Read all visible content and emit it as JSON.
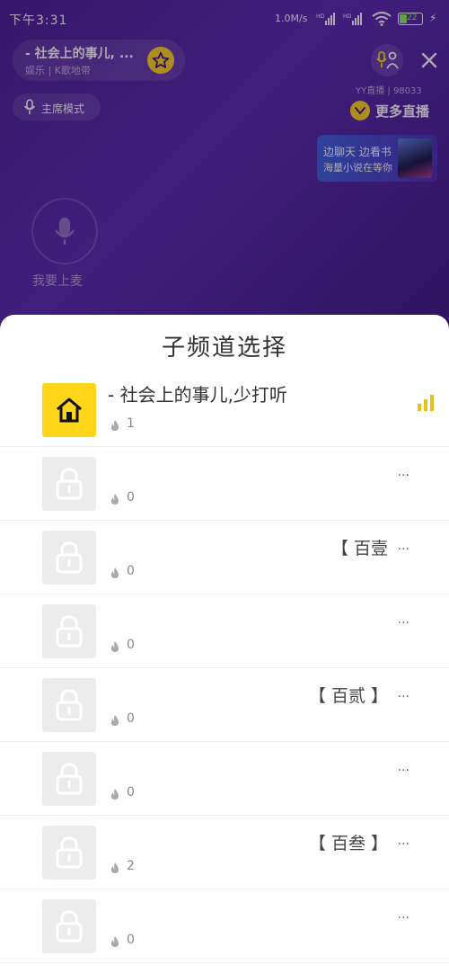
{
  "status_bar": {
    "time": "下午3:31",
    "network_speed": "1.0M/s",
    "sim1": "HD",
    "sim2": "HD",
    "battery": "22"
  },
  "room": {
    "title": "- 社会上的事儿, ...",
    "subtitle": "娱乐 | K歌地带"
  },
  "mode_button": "主席模式",
  "yy_info": "YY直播 | 98033",
  "more_live": "更多直播",
  "ad": {
    "line1": "边聊天 边看书",
    "line2": "海量小说在等你"
  },
  "mic_label": "我要上麦",
  "sheet": {
    "title": "子频道选择",
    "rows": [
      {
        "name": "- 社会上的事儿,少打听",
        "count": "1",
        "locked": false,
        "ellipsis": ""
      },
      {
        "name": "",
        "count": "0",
        "locked": true,
        "ellipsis": "..."
      },
      {
        "name": "【 百壹",
        "count": "0",
        "locked": true,
        "ellipsis": "..."
      },
      {
        "name": "",
        "count": "0",
        "locked": true,
        "ellipsis": "..."
      },
      {
        "name": "【 百贰 】",
        "count": "0",
        "locked": true,
        "ellipsis": "..."
      },
      {
        "name": "",
        "count": "0",
        "locked": true,
        "ellipsis": "..."
      },
      {
        "name": "【 百叁 】",
        "count": "2",
        "locked": true,
        "ellipsis": "..."
      },
      {
        "name": "",
        "count": "0",
        "locked": true,
        "ellipsis": "..."
      }
    ]
  },
  "colors": {
    "accent_yellow": "#ffd51a",
    "bg_purple": "#4a1f8f"
  }
}
